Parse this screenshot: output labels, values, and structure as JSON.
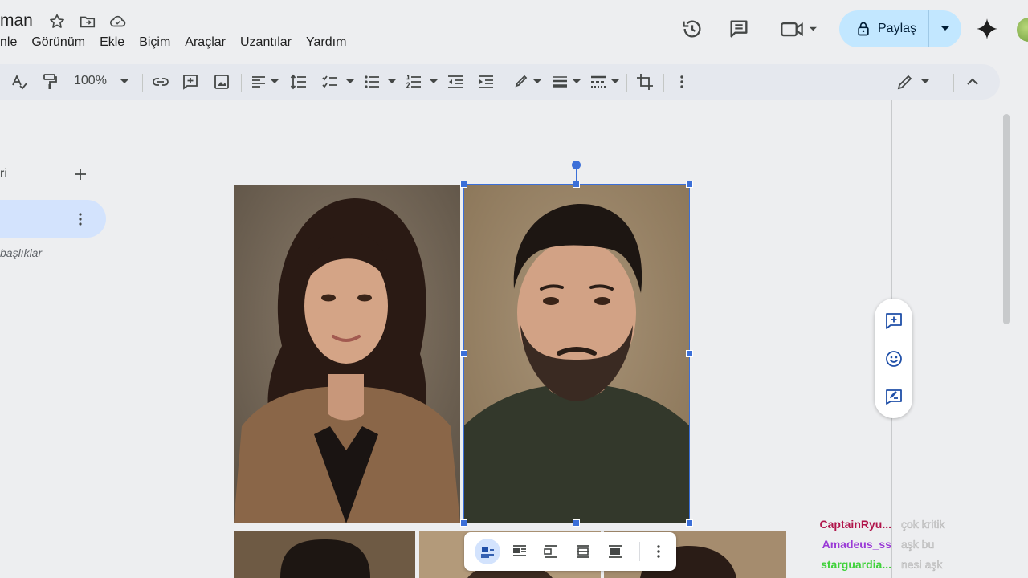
{
  "header": {
    "doc_title": "man",
    "menu": [
      "nle",
      "Görünüm",
      "Ekle",
      "Biçim",
      "Araçlar",
      "Uzantılar",
      "Yardım"
    ],
    "share_label": "Paylaş"
  },
  "toolbar": {
    "zoom": "100%"
  },
  "outline": {
    "label": "ri",
    "hint": "başlıklar"
  },
  "chat": [
    {
      "user": "CaptainRyu...",
      "message": "çok kritik",
      "color": "#b0144a"
    },
    {
      "user": "Amadeus_ss",
      "message": "aşk bu",
      "color": "#9a3ad6"
    },
    {
      "user": "starguardia...",
      "message": "nesi aşk",
      "color": "#3fd13a"
    }
  ],
  "colors": {
    "accent": "#3b6fd8",
    "share_bg": "#c2e7ff",
    "toolbar_bg": "#e5e8ee"
  }
}
